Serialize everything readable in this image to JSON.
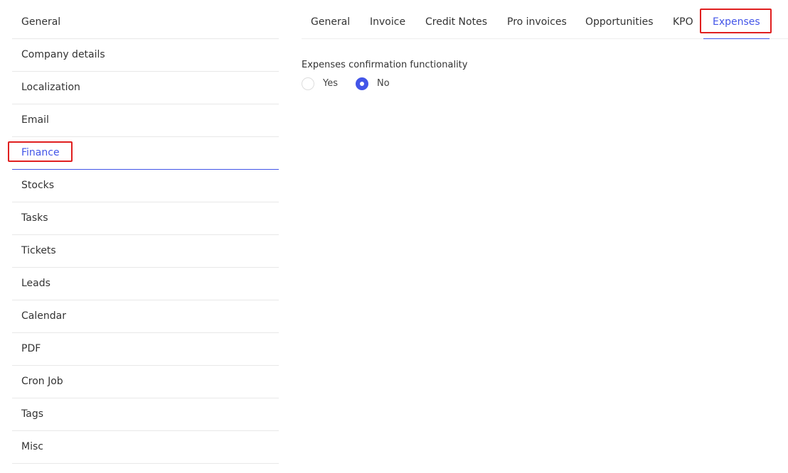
{
  "colors": {
    "accent": "#4355e8",
    "highlight": "#e01f1f",
    "divider": "#e8e8e8",
    "text": "#333333"
  },
  "sidebar": {
    "items": [
      {
        "label": "General"
      },
      {
        "label": "Company details"
      },
      {
        "label": "Localization"
      },
      {
        "label": "Email"
      },
      {
        "label": "Finance",
        "active": true
      },
      {
        "label": "Stocks"
      },
      {
        "label": "Tasks"
      },
      {
        "label": "Tickets"
      },
      {
        "label": "Leads"
      },
      {
        "label": "Calendar"
      },
      {
        "label": "PDF"
      },
      {
        "label": "Cron Job"
      },
      {
        "label": "Tags"
      },
      {
        "label": "Misc"
      }
    ]
  },
  "tabs": [
    {
      "label": "General"
    },
    {
      "label": "Invoice"
    },
    {
      "label": "Credit Notes"
    },
    {
      "label": "Pro invoices"
    },
    {
      "label": "Opportunities"
    },
    {
      "label": "KPO"
    },
    {
      "label": "Expenses",
      "active": true
    }
  ],
  "form": {
    "field_label": "Expenses confirmation functionality",
    "options": [
      {
        "label": "Yes",
        "checked": false
      },
      {
        "label": "No",
        "checked": true
      }
    ]
  }
}
